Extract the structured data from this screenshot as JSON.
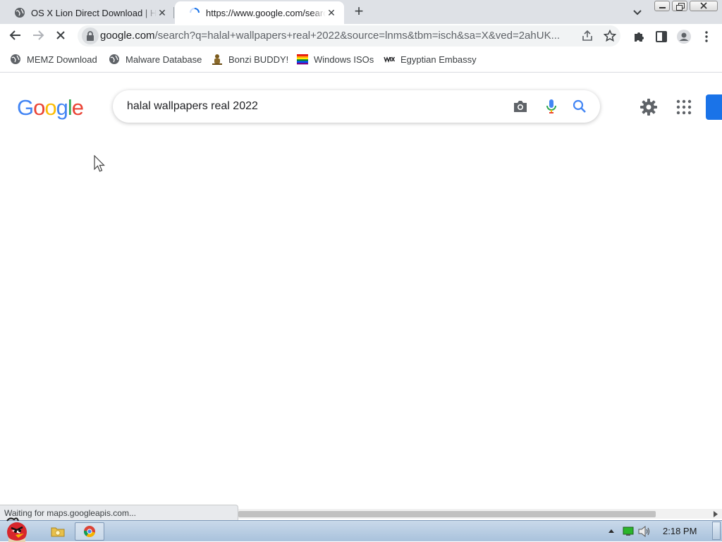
{
  "tabs": [
    {
      "title": "OS X Lion Direct Download | Hi",
      "active": false,
      "close": "✕",
      "favicon": "globe-icon"
    },
    {
      "title": "https://www.google.com/search?q",
      "active": true,
      "close": "✕",
      "favicon": "loading-spinner-icon"
    }
  ],
  "new_tab": "+",
  "omnibox": {
    "host": "google.com",
    "path": "/search?q=halal+wallpapers+real+2022&source=lnms&tbm=isch&sa=X&ved=2ahUK..."
  },
  "bookmarks": [
    {
      "label": "MEMZ Download",
      "icon": "globe-icon"
    },
    {
      "label": "Malware Database",
      "icon": "globe-icon"
    },
    {
      "label": "Bonzi BUDDY!",
      "icon": "bonzi-icon"
    },
    {
      "label": "Windows ISOs",
      "icon": "rainbow-flag-icon"
    },
    {
      "label": "Egyptian Embassy",
      "icon": "wix-icon"
    }
  ],
  "google": {
    "logo_letters": [
      "G",
      "o",
      "o",
      "g",
      "l",
      "e"
    ],
    "query": "halal wallpapers real 2022"
  },
  "colors": {
    "google_blue": "#4285F4",
    "google_red": "#EA4335",
    "google_yellow": "#FBBC05",
    "google_green": "#34A853",
    "signin_blue": "#1a73e8"
  },
  "status_text": "Waiting for maps.googleapis.com...",
  "taskbar": {
    "clock": "2:18 PM"
  }
}
